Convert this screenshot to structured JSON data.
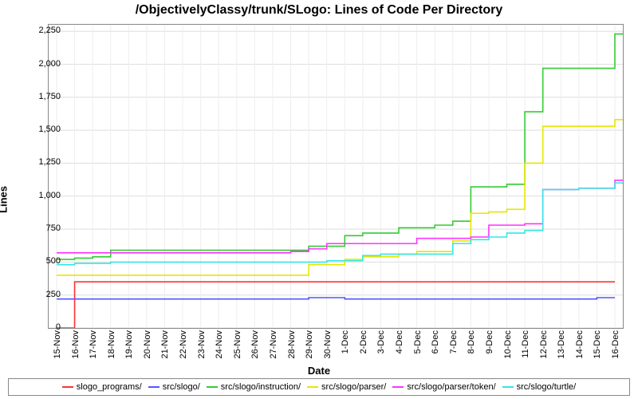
{
  "chart_data": {
    "type": "line",
    "title": "/ObjectivelyClassy/trunk/SLogo: Lines of Code Per Directory",
    "xlabel": "Date",
    "ylabel": "Lines",
    "ylim": [
      0,
      2300
    ],
    "y_ticks": [
      0,
      250,
      500,
      750,
      1000,
      1250,
      1500,
      1750,
      2000,
      2250
    ],
    "y_tick_labels": [
      "0",
      "250",
      "500",
      "750",
      "1,000",
      "1,250",
      "1,500",
      "1,750",
      "2,000",
      "2,250"
    ],
    "categories": [
      "15-Nov",
      "16-Nov",
      "17-Nov",
      "18-Nov",
      "19-Nov",
      "20-Nov",
      "21-Nov",
      "22-Nov",
      "23-Nov",
      "24-Nov",
      "25-Nov",
      "26-Nov",
      "27-Nov",
      "28-Nov",
      "29-Nov",
      "30-Nov",
      "1-Dec",
      "2-Dec",
      "3-Dec",
      "4-Dec",
      "5-Dec",
      "6-Dec",
      "7-Dec",
      "8-Dec",
      "9-Dec",
      "10-Dec",
      "11-Dec",
      "12-Dec",
      "13-Dec",
      "14-Dec",
      "15-Dec",
      "16-Dec"
    ],
    "series": [
      {
        "name": "slogo_programs/",
        "color": "#FF3333",
        "values": [
          0,
          350,
          350,
          350,
          350,
          350,
          350,
          350,
          350,
          350,
          350,
          350,
          350,
          350,
          350,
          350,
          350,
          350,
          350,
          350,
          350,
          350,
          350,
          350,
          350,
          350,
          350,
          350,
          350,
          350,
          350,
          350
        ]
      },
      {
        "name": "src/slogo/",
        "color": "#5555FF",
        "values": [
          220,
          220,
          220,
          220,
          220,
          220,
          220,
          220,
          220,
          220,
          220,
          220,
          220,
          220,
          230,
          230,
          220,
          220,
          220,
          220,
          220,
          220,
          220,
          220,
          220,
          220,
          220,
          220,
          220,
          220,
          230,
          230
        ]
      },
      {
        "name": "src/slogo/instruction/",
        "color": "#33CC33",
        "values": [
          520,
          530,
          540,
          590,
          590,
          590,
          590,
          590,
          590,
          590,
          590,
          590,
          590,
          590,
          620,
          620,
          700,
          720,
          720,
          760,
          760,
          780,
          810,
          1070,
          1070,
          1090,
          1640,
          1970,
          1970,
          1970,
          1970,
          2230,
          2240
        ]
      },
      {
        "name": "src/slogo/parser/",
        "color": "#E6E600",
        "values": [
          400,
          400,
          400,
          400,
          400,
          400,
          400,
          400,
          400,
          400,
          400,
          400,
          400,
          400,
          480,
          480,
          520,
          540,
          540,
          560,
          580,
          580,
          660,
          870,
          880,
          900,
          1250,
          1530,
          1530,
          1530,
          1530,
          1580,
          1590
        ]
      },
      {
        "name": "src/slogo/parser/token/",
        "color": "#FF33FF",
        "values": [
          570,
          570,
          570,
          570,
          570,
          570,
          570,
          570,
          570,
          570,
          570,
          570,
          570,
          580,
          600,
          640,
          640,
          640,
          640,
          640,
          680,
          680,
          680,
          690,
          780,
          780,
          790,
          1050,
          1050,
          1060,
          1060,
          1120,
          1160
        ]
      },
      {
        "name": "src/slogo/turtle/",
        "color": "#33E6E6",
        "values": [
          480,
          490,
          490,
          500,
          500,
          500,
          500,
          500,
          500,
          500,
          500,
          500,
          500,
          500,
          500,
          510,
          510,
          550,
          560,
          560,
          560,
          560,
          640,
          670,
          690,
          720,
          740,
          1050,
          1050,
          1060,
          1060,
          1100,
          1200
        ]
      }
    ]
  }
}
